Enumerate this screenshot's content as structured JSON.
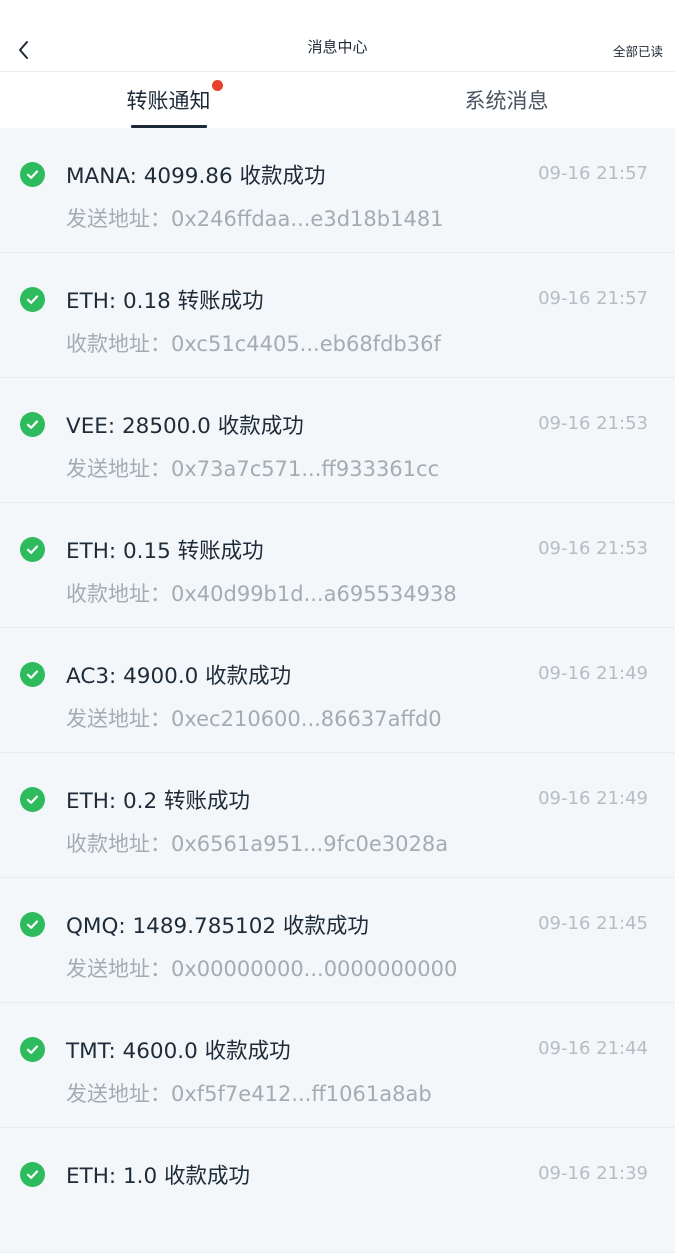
{
  "header": {
    "title": "消息中心",
    "read_all": "全部已读"
  },
  "tabs": [
    {
      "label": "转账通知",
      "active": true,
      "has_dot": true
    },
    {
      "label": "系统消息",
      "active": false,
      "has_dot": false
    }
  ],
  "colors": {
    "success": "#2dbb5d",
    "badge": "#e8412c",
    "text_primary": "#1e2b38",
    "text_secondary": "#a3abb3"
  },
  "messages": [
    {
      "title": "MANA: 4099.86 收款成功",
      "time": "09-16 21:57",
      "address": "发送地址：0x246ffdaa...e3d18b1481"
    },
    {
      "title": "ETH: 0.18 转账成功",
      "time": "09-16 21:57",
      "address": "收款地址：0xc51c4405...eb68fdb36f"
    },
    {
      "title": "VEE: 28500.0 收款成功",
      "time": "09-16 21:53",
      "address": "发送地址：0x73a7c571...ff933361cc"
    },
    {
      "title": "ETH: 0.15 转账成功",
      "time": "09-16 21:53",
      "address": "收款地址：0x40d99b1d...a695534938"
    },
    {
      "title": "AC3: 4900.0 收款成功",
      "time": "09-16 21:49",
      "address": "发送地址：0xec210600...86637affd0"
    },
    {
      "title": "ETH: 0.2 转账成功",
      "time": "09-16 21:49",
      "address": "收款地址：0x6561a951...9fc0e3028a"
    },
    {
      "title": "QMQ: 1489.785102 收款成功",
      "time": "09-16 21:45",
      "address": "发送地址：0x00000000...0000000000"
    },
    {
      "title": "TMT: 4600.0 收款成功",
      "time": "09-16 21:44",
      "address": "发送地址：0xf5f7e412...ff1061a8ab"
    },
    {
      "title": "ETH: 1.0 收款成功",
      "time": "09-16 21:39",
      "address": ""
    }
  ]
}
